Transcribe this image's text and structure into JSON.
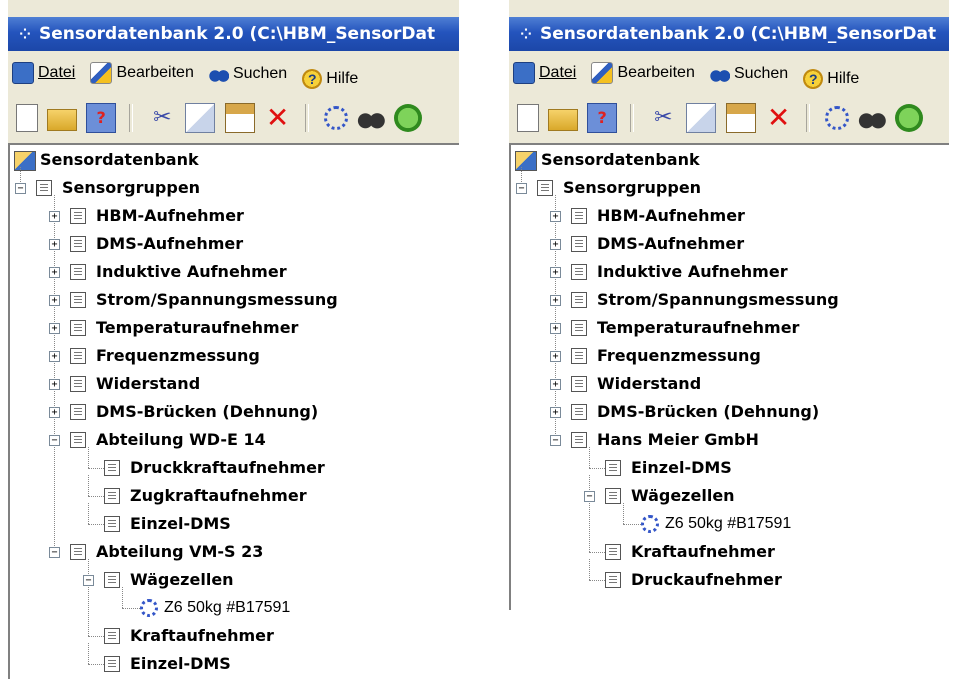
{
  "window_title": "Sensordatenbank 2.0 (C:\\HBM_SensorDat",
  "menu": [
    "Datei",
    "Bearbeiten",
    "Suchen",
    "Hilfe"
  ],
  "toolbar_icons": [
    "new-icon",
    "open-icon",
    "help-icon",
    "cut-icon",
    "copy-icon",
    "paste-icon",
    "delete-icon",
    "sensor-icon",
    "find-icon",
    "next-icon"
  ],
  "left": {
    "tree": [
      {
        "label": "Sensordatenbank",
        "depth": 0,
        "type": "root"
      },
      {
        "label": "Sensorgruppen",
        "depth": 1,
        "toggle": "-"
      },
      {
        "label": "HBM-Aufnehmer",
        "depth": 2,
        "toggle": "+"
      },
      {
        "label": "DMS-Aufnehmer",
        "depth": 2,
        "toggle": "+"
      },
      {
        "label": "Induktive Aufnehmer",
        "depth": 2,
        "toggle": "+"
      },
      {
        "label": "Strom/Spannungsmessung",
        "depth": 2,
        "toggle": "+"
      },
      {
        "label": "Temperaturaufnehmer",
        "depth": 2,
        "toggle": "+"
      },
      {
        "label": "Frequenzmessung",
        "depth": 2,
        "toggle": "+"
      },
      {
        "label": "Widerstand",
        "depth": 2,
        "toggle": "+"
      },
      {
        "label": "DMS-Brücken (Dehnung)",
        "depth": 2,
        "toggle": "+"
      },
      {
        "label": "Abteilung WD-E 14",
        "depth": 2,
        "toggle": "-"
      },
      {
        "label": "Druckkraftaufnehmer",
        "depth": 3
      },
      {
        "label": "Zugkraftaufnehmer",
        "depth": 3
      },
      {
        "label": "Einzel-DMS",
        "depth": 3
      },
      {
        "label": "Abteilung VM-S 23",
        "depth": 2,
        "toggle": "-"
      },
      {
        "label": "Wägezellen",
        "depth": 3,
        "toggle": "-"
      },
      {
        "label": "Z6 50kg #B17591",
        "depth": 4,
        "type": "sensor"
      },
      {
        "label": "Kraftaufnehmer",
        "depth": 3
      },
      {
        "label": "Einzel-DMS",
        "depth": 3
      }
    ]
  },
  "right": {
    "tree": [
      {
        "label": "Sensordatenbank",
        "depth": 0,
        "type": "root"
      },
      {
        "label": "Sensorgruppen",
        "depth": 1,
        "toggle": "-"
      },
      {
        "label": "HBM-Aufnehmer",
        "depth": 2,
        "toggle": "+"
      },
      {
        "label": "DMS-Aufnehmer",
        "depth": 2,
        "toggle": "+"
      },
      {
        "label": "Induktive Aufnehmer",
        "depth": 2,
        "toggle": "+"
      },
      {
        "label": "Strom/Spannungsmessung",
        "depth": 2,
        "toggle": "+"
      },
      {
        "label": "Temperaturaufnehmer",
        "depth": 2,
        "toggle": "+"
      },
      {
        "label": "Frequenzmessung",
        "depth": 2,
        "toggle": "+"
      },
      {
        "label": "Widerstand",
        "depth": 2,
        "toggle": "+"
      },
      {
        "label": "DMS-Brücken (Dehnung)",
        "depth": 2,
        "toggle": "+"
      },
      {
        "label": "Hans Meier GmbH",
        "depth": 2,
        "toggle": "-"
      },
      {
        "label": "Einzel-DMS",
        "depth": 3
      },
      {
        "label": "Wägezellen",
        "depth": 3,
        "toggle": "-"
      },
      {
        "label": "Z6 50kg #B17591",
        "depth": 4,
        "type": "sensor"
      },
      {
        "label": "Kraftaufnehmer",
        "depth": 3
      },
      {
        "label": "Druckaufnehmer",
        "depth": 3
      }
    ]
  },
  "colors": {
    "titlebar": "#2454bd",
    "window_bg": "#ece9d8",
    "sensor_icon": "#3456c8"
  }
}
